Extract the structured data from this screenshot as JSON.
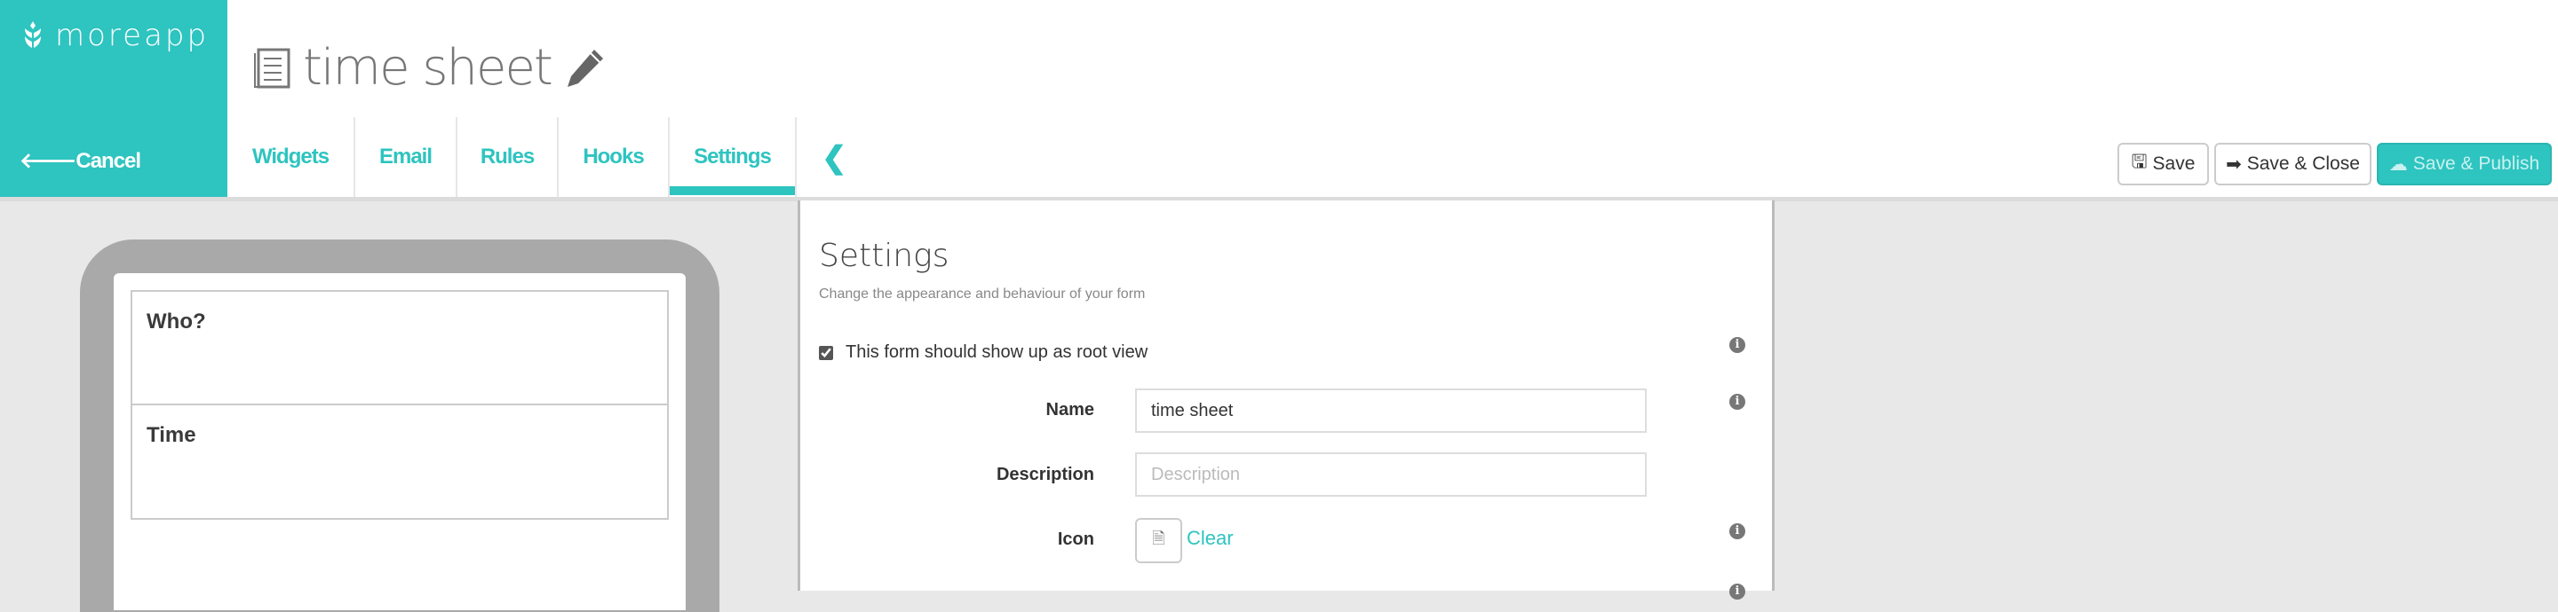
{
  "brand": {
    "name": "moreapp"
  },
  "nav": {
    "cancel": "Cancel"
  },
  "header": {
    "title": "time sheet"
  },
  "tabs": [
    {
      "label": "Widgets"
    },
    {
      "label": "Email"
    },
    {
      "label": "Rules"
    },
    {
      "label": "Hooks"
    },
    {
      "label": "Settings",
      "active": true
    }
  ],
  "actions": {
    "save": "Save",
    "save_close": "Save & Close",
    "save_publish": "Save & Publish"
  },
  "preview": {
    "widgets": [
      {
        "label": "Who?"
      },
      {
        "label": "Time"
      }
    ]
  },
  "settings": {
    "title": "Settings",
    "subtitle": "Change the appearance and behaviour of your form",
    "root_view_label": "This form should show up as root view",
    "root_view_checked": true,
    "name_label": "Name",
    "name_value": "time sheet",
    "description_label": "Description",
    "description_placeholder": "Description",
    "description_value": "",
    "icon_label": "Icon",
    "clear_label": "Clear"
  },
  "colors": {
    "accent": "#2ec4c0",
    "background": "#e8e8e8",
    "phone_frame": "#a9a9a9"
  }
}
